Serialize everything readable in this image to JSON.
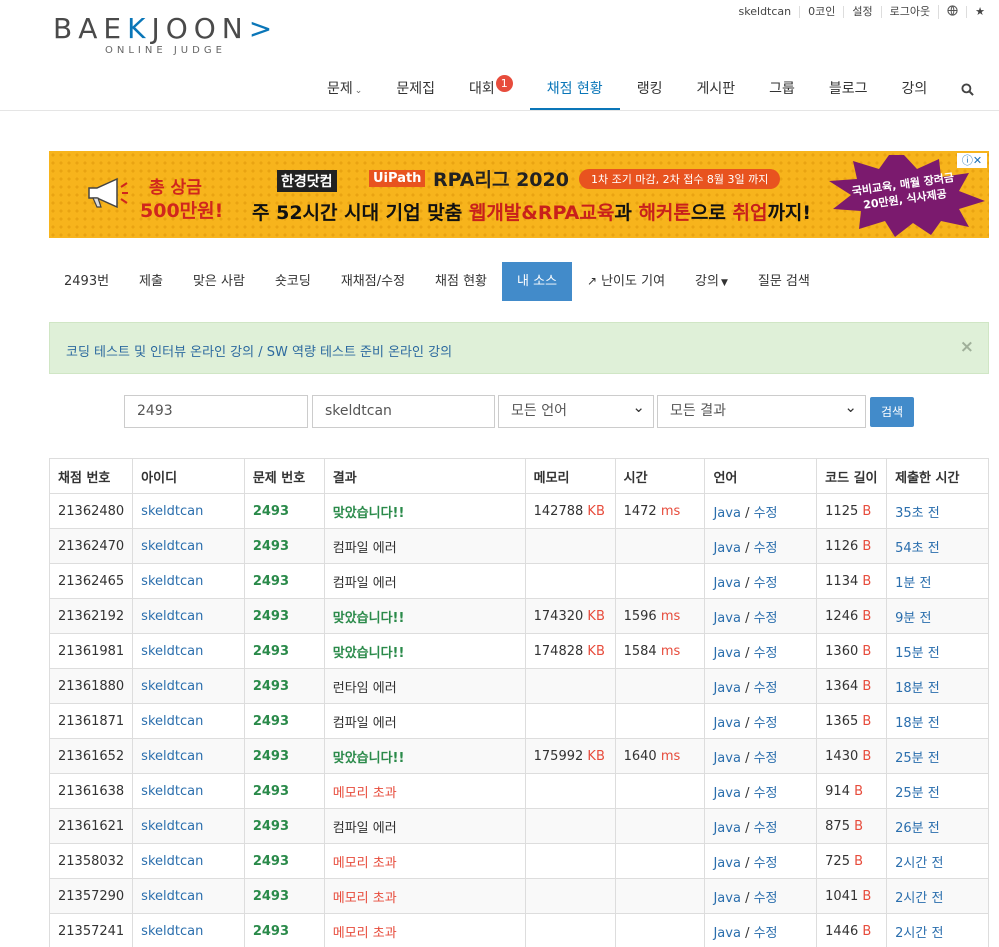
{
  "topbar": {
    "user": "skeldtcan",
    "coins": "0코인",
    "settings": "설정",
    "logout": "로그아웃"
  },
  "logo": {
    "main_a": "BAE",
    "main_b": "K",
    "main_c": "JOON",
    "main_d": ">",
    "sub": "ONLINE JUDGE"
  },
  "nav": {
    "items": [
      "문제",
      "문제집",
      "대회",
      "채점 현황",
      "랭킹",
      "게시판",
      "그룹",
      "블로그",
      "강의"
    ],
    "contest_badge": "1"
  },
  "banner": {
    "prize_line1": "총 상금",
    "prize_line2": "500만원!",
    "tag1": "한경닷컴",
    "tag2": "UiPath",
    "title": "RPA리그 2020",
    "deadline": "1차 조기 마감, 2차 접수 8월 3일 까지",
    "headline_a": "주 52시간 시대 기업 맞춤 ",
    "headline_b": "웹개발&RPA교육",
    "headline_c": "과 ",
    "headline_d": "해커톤",
    "headline_e": "으로 ",
    "headline_f": "취업",
    "headline_g": "까지!",
    "burst": "국비교육, 매월 장려금 20만원, 식사제공"
  },
  "subnav": {
    "items": [
      "2493번",
      "제출",
      "맞은 사람",
      "숏코딩",
      "재채점/수정",
      "채점 현황",
      "내 소스",
      "난이도 기여",
      "강의",
      "질문 검색"
    ]
  },
  "alert": {
    "text": "코딩 테스트 및 인터뷰 온라인 강의 / SW 역량 테스트 준비 온라인 강의",
    "close": "×"
  },
  "search": {
    "problem_id": "2493",
    "user_id": "skeldtcan",
    "language": "모든 언어",
    "result": "모든 결과",
    "button": "검색"
  },
  "table": {
    "headers": [
      "채점 번호",
      "아이디",
      "문제 번호",
      "결과",
      "메모리",
      "시간",
      "언어",
      "코드 길이",
      "제출한 시간"
    ],
    "rows": [
      {
        "id": "21362480",
        "user": "skeldtcan",
        "problem": "2493",
        "result": "맞았습니다!!",
        "status": "ac",
        "memory": "142788",
        "time": "1472",
        "lang": "Java",
        "edit": "수정",
        "length": "1125",
        "submitted": "35초 전"
      },
      {
        "id": "21362470",
        "user": "skeldtcan",
        "problem": "2493",
        "result": "컴파일 에러",
        "status": "ce",
        "memory": "",
        "time": "",
        "lang": "Java",
        "edit": "수정",
        "length": "1126",
        "submitted": "54초 전"
      },
      {
        "id": "21362465",
        "user": "skeldtcan",
        "problem": "2493",
        "result": "컴파일 에러",
        "status": "ce",
        "memory": "",
        "time": "",
        "lang": "Java",
        "edit": "수정",
        "length": "1134",
        "submitted": "1분 전"
      },
      {
        "id": "21362192",
        "user": "skeldtcan",
        "problem": "2493",
        "result": "맞았습니다!!",
        "status": "ac",
        "memory": "174320",
        "time": "1596",
        "lang": "Java",
        "edit": "수정",
        "length": "1246",
        "submitted": "9분 전"
      },
      {
        "id": "21361981",
        "user": "skeldtcan",
        "problem": "2493",
        "result": "맞았습니다!!",
        "status": "ac",
        "memory": "174828",
        "time": "1584",
        "lang": "Java",
        "edit": "수정",
        "length": "1360",
        "submitted": "15분 전"
      },
      {
        "id": "21361880",
        "user": "skeldtcan",
        "problem": "2493",
        "result": "런타임 에러",
        "status": "ce",
        "memory": "",
        "time": "",
        "lang": "Java",
        "edit": "수정",
        "length": "1364",
        "submitted": "18분 전"
      },
      {
        "id": "21361871",
        "user": "skeldtcan",
        "problem": "2493",
        "result": "컴파일 에러",
        "status": "ce",
        "memory": "",
        "time": "",
        "lang": "Java",
        "edit": "수정",
        "length": "1365",
        "submitted": "18분 전"
      },
      {
        "id": "21361652",
        "user": "skeldtcan",
        "problem": "2493",
        "result": "맞았습니다!!",
        "status": "ac",
        "memory": "175992",
        "time": "1640",
        "lang": "Java",
        "edit": "수정",
        "length": "1430",
        "submitted": "25분 전"
      },
      {
        "id": "21361638",
        "user": "skeldtcan",
        "problem": "2493",
        "result": "메모리 초과",
        "status": "mle",
        "memory": "",
        "time": "",
        "lang": "Java",
        "edit": "수정",
        "length": "914",
        "submitted": "25분 전"
      },
      {
        "id": "21361621",
        "user": "skeldtcan",
        "problem": "2493",
        "result": "컴파일 에러",
        "status": "ce",
        "memory": "",
        "time": "",
        "lang": "Java",
        "edit": "수정",
        "length": "875",
        "submitted": "26분 전"
      },
      {
        "id": "21358032",
        "user": "skeldtcan",
        "problem": "2493",
        "result": "메모리 초과",
        "status": "mle",
        "memory": "",
        "time": "",
        "lang": "Java",
        "edit": "수정",
        "length": "725",
        "submitted": "2시간 전"
      },
      {
        "id": "21357290",
        "user": "skeldtcan",
        "problem": "2493",
        "result": "메모리 초과",
        "status": "mle",
        "memory": "",
        "time": "",
        "lang": "Java",
        "edit": "수정",
        "length": "1041",
        "submitted": "2시간 전"
      },
      {
        "id": "21357241",
        "user": "skeldtcan",
        "problem": "2493",
        "result": "메모리 초과",
        "status": "mle",
        "memory": "",
        "time": "",
        "lang": "Java",
        "edit": "수정",
        "length": "1446",
        "submitted": "2시간 전"
      }
    ],
    "units": {
      "memory": "KB",
      "time": "ms",
      "length": "B",
      "sep": "/"
    }
  }
}
